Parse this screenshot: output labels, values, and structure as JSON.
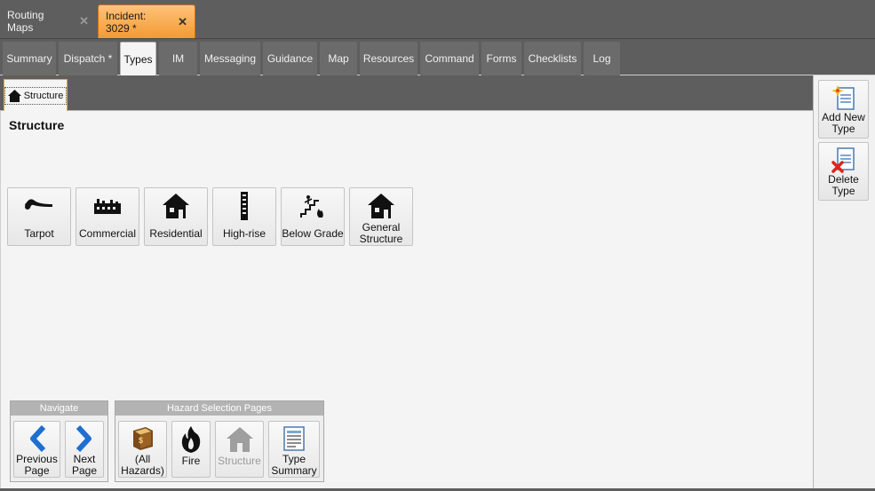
{
  "doc_tabs": [
    {
      "label": "Routing Maps",
      "close": "✕"
    },
    {
      "label": "Incident: 3029 *",
      "close": "✕"
    }
  ],
  "nav_tabs": [
    "Summary",
    "Dispatch *",
    "Types",
    "IM",
    "Messaging",
    "Guidance",
    "Map",
    "Resources",
    "Command",
    "Forms",
    "Checklists",
    "Log"
  ],
  "active_nav_tab": "Types",
  "sub_tab": {
    "label": "Structure",
    "icon": "house-icon"
  },
  "page_title": "Structure",
  "types": [
    {
      "label": "Tarpot",
      "icon": "tarpot-icon"
    },
    {
      "label": "Commercial",
      "icon": "factory-icon"
    },
    {
      "label": "Residential",
      "icon": "house-icon"
    },
    {
      "label": "High-rise",
      "icon": "highrise-icon"
    },
    {
      "label": "Below Grade",
      "icon": "stairs-fire-icon"
    },
    {
      "label": "General Structure",
      "icon": "house-icon"
    }
  ],
  "navigate_group": {
    "title": "Navigate",
    "previous": "Previous Page",
    "next": "Next Page"
  },
  "hazard_group": {
    "title": "Hazard Selection Pages",
    "all_hazards": "(All Hazards)",
    "fire": "Fire",
    "structure": "Structure",
    "type_summary": "Type Summary"
  },
  "right_panel": {
    "add": "Add New Type",
    "delete": "Delete Type"
  },
  "colors": {
    "active_doc_tab": "#f39a32",
    "nav_arrow": "#1f6fd1",
    "fire": "#111111"
  }
}
